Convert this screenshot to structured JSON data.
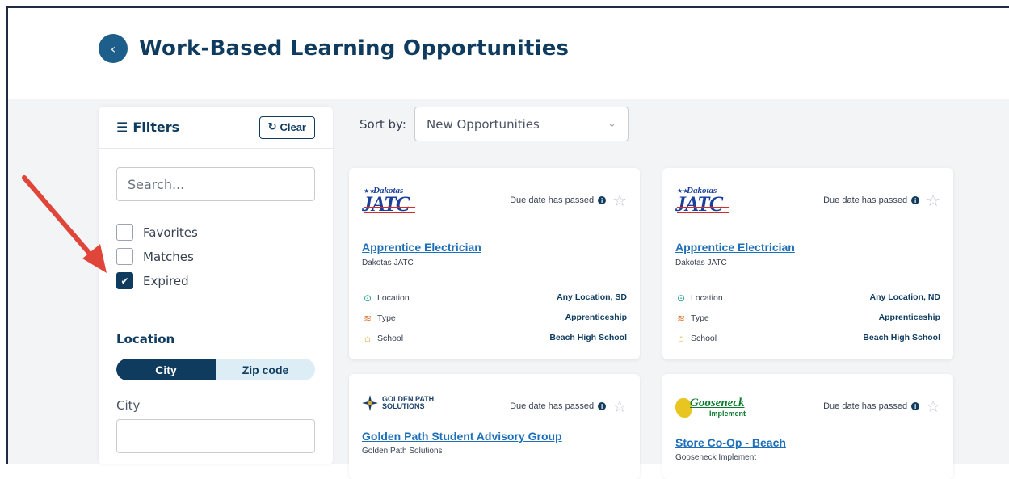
{
  "header": {
    "title": "Work-Based Learning Opportunities",
    "back_label": "‹"
  },
  "filters": {
    "title": "Filters",
    "clear_label": "Clear",
    "search_placeholder": "Search...",
    "checkboxes": [
      {
        "label": "Favorites",
        "checked": false
      },
      {
        "label": "Matches",
        "checked": false
      },
      {
        "label": "Expired",
        "checked": true
      }
    ],
    "location": {
      "title": "Location",
      "toggle": [
        "City",
        "Zip code"
      ],
      "active": "City",
      "city_label": "City",
      "city_value": ""
    }
  },
  "sort": {
    "label": "Sort by:",
    "value": "New Opportunities"
  },
  "cards": [
    {
      "logo": "Dakotas JATC",
      "due": "Due date has passed",
      "title": "Apprentice Electrician",
      "org": "Dakotas JATC",
      "details": [
        {
          "label": "Location",
          "value": "Any Location, SD"
        },
        {
          "label": "Type",
          "value": "Apprenticeship"
        },
        {
          "label": "School",
          "value": "Beach High School"
        }
      ]
    },
    {
      "logo": "Dakotas JATC",
      "due": "Due date has passed",
      "title": "Apprentice Electrician",
      "org": "Dakotas JATC",
      "details": [
        {
          "label": "Location",
          "value": "Any Location, ND"
        },
        {
          "label": "Type",
          "value": "Apprenticeship"
        },
        {
          "label": "School",
          "value": "Beach High School"
        }
      ]
    },
    {
      "logo": "GOLDEN PATH SOLUTIONS",
      "logo_lines": [
        "GOLDEN PATH",
        "SOLUTIONS"
      ],
      "due": "Due date has passed",
      "title": "Golden Path Student Advisory Group",
      "org": "Golden Path Solutions"
    },
    {
      "logo": "Gooseneck Implement",
      "logo_lines": [
        "Gooseneck",
        "Implement"
      ],
      "due": "Due date has passed",
      "title": "Store Co-Op - Beach",
      "org": "Gooseneck Implement"
    }
  ],
  "colors": {
    "primary": "#0f3b5f",
    "link": "#1d6fb8",
    "annotation_arrow": "#e0453a"
  }
}
